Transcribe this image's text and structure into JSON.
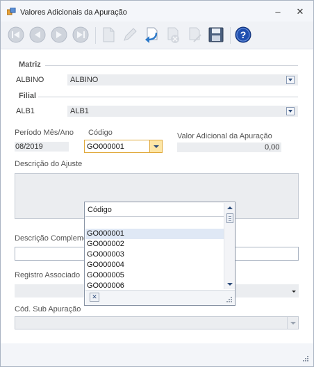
{
  "window": {
    "title": "Valores Adicionais da Apuração",
    "minimize_glyph": "–",
    "close_glyph": "✕"
  },
  "toolbar": {
    "icons": [
      "first-record-icon",
      "previous-record-icon",
      "next-record-icon",
      "last-record-icon",
      "new-icon",
      "edit-icon",
      "undo-icon",
      "delete-icon",
      "cancel-icon",
      "save-icon",
      "help-icon"
    ],
    "help_glyph": "?"
  },
  "matriz": {
    "label": "Matriz",
    "code": "ALBINO",
    "name": "ALBINO"
  },
  "filial": {
    "label": "Filial",
    "code": "ALB1",
    "name": "ALB1"
  },
  "periodo": {
    "label": "Período Mês/Ano",
    "value": "08/2019"
  },
  "codigo": {
    "label": "Código",
    "value": "GO000001"
  },
  "valor_adicional": {
    "label": "Valor Adicional da Apuração",
    "value": "0,00"
  },
  "descricao_ajuste": {
    "label": "Descrição do Ajuste"
  },
  "descricao_complementar": {
    "label": "Descrição Complementar"
  },
  "registro_associado": {
    "label": "Registro Associado",
    "value": ""
  },
  "cod_sub_apuracao": {
    "label": "Cód. Sub Apuração",
    "value": ""
  },
  "codigo_popup": {
    "header": "Código",
    "items": [
      "GO000001",
      "GO000002",
      "GO000003",
      "GO000004",
      "GO000005",
      "GO000006"
    ],
    "selected_index": 0,
    "clear_glyph": "✕"
  },
  "colors": {
    "accent": "#2e5fa8",
    "selection": "#dfe8f5",
    "field_bg": "#ebedf0"
  }
}
